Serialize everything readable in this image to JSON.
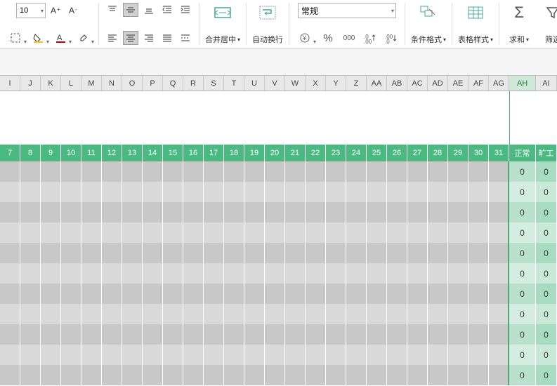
{
  "ribbon": {
    "font_size": "10",
    "merge_center": "合并居中",
    "auto_wrap": "自动换行",
    "number_format": "常规",
    "cond_format": "条件格式",
    "table_style": "表格样式",
    "sum": "求和",
    "filter": "筛选"
  },
  "col_headers": [
    "I",
    "J",
    "K",
    "L",
    "M",
    "N",
    "O",
    "P",
    "Q",
    "R",
    "S",
    "T",
    "U",
    "V",
    "W",
    "X",
    "Y",
    "Z",
    "AA",
    "AB",
    "AC",
    "AD",
    "AE",
    "AF",
    "AG",
    "AH",
    "AI"
  ],
  "active_col": "AH",
  "green_header": {
    "days": [
      "7",
      "8",
      "9",
      "10",
      "11",
      "12",
      "13",
      "14",
      "15",
      "16",
      "17",
      "18",
      "19",
      "20",
      "21",
      "22",
      "23",
      "24",
      "25",
      "26",
      "27",
      "28",
      "29",
      "30",
      "31"
    ],
    "normal": "正常",
    "absent": "旷工"
  },
  "rows": [
    {
      "normal": "0",
      "absent": "0"
    },
    {
      "normal": "0",
      "absent": "0"
    },
    {
      "normal": "0",
      "absent": "0"
    },
    {
      "normal": "0",
      "absent": "0"
    },
    {
      "normal": "0",
      "absent": "0"
    },
    {
      "normal": "0",
      "absent": "0"
    },
    {
      "normal": "0",
      "absent": "0"
    },
    {
      "normal": "0",
      "absent": "0"
    },
    {
      "normal": "0",
      "absent": "0"
    },
    {
      "normal": "0",
      "absent": "0"
    },
    {
      "normal": "0",
      "absent": "0"
    }
  ],
  "col_widths": {
    "day": 29,
    "normal": 38,
    "absent": 30
  }
}
